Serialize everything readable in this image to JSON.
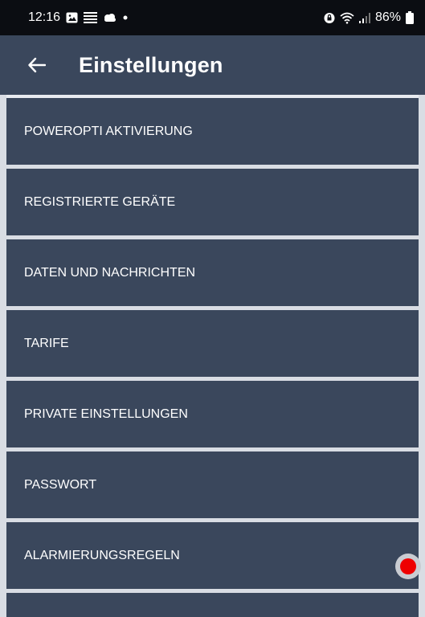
{
  "status_bar": {
    "time": "12:16",
    "battery_percent": "86%",
    "icons_left": [
      "gallery-icon",
      "notes-icon",
      "cloud-icon",
      "dot-icon"
    ],
    "icons_right": [
      "shield-lock-icon",
      "wifi-icon",
      "signal-icon",
      "battery-icon"
    ]
  },
  "header": {
    "title": "Einstellungen",
    "back_icon": "arrow-left-icon"
  },
  "menu": {
    "items": [
      {
        "label": "POWEROPTI AKTIVIERUNG"
      },
      {
        "label": "REGISTRIERTE GERÄTE"
      },
      {
        "label": "DATEN UND NACHRICHTEN"
      },
      {
        "label": "TARIFE"
      },
      {
        "label": "PRIVATE EINSTELLUNGEN"
      },
      {
        "label": "PASSWORT"
      },
      {
        "label": "ALARMIERUNGSREGELN"
      },
      {
        "label": ""
      }
    ]
  },
  "colors": {
    "status_bar_bg": "#0b0d12",
    "header_bg": "#3a475c",
    "item_bg": "#3a475c",
    "separator": "#d9dde4",
    "touch_indicator": "#ee0000"
  }
}
